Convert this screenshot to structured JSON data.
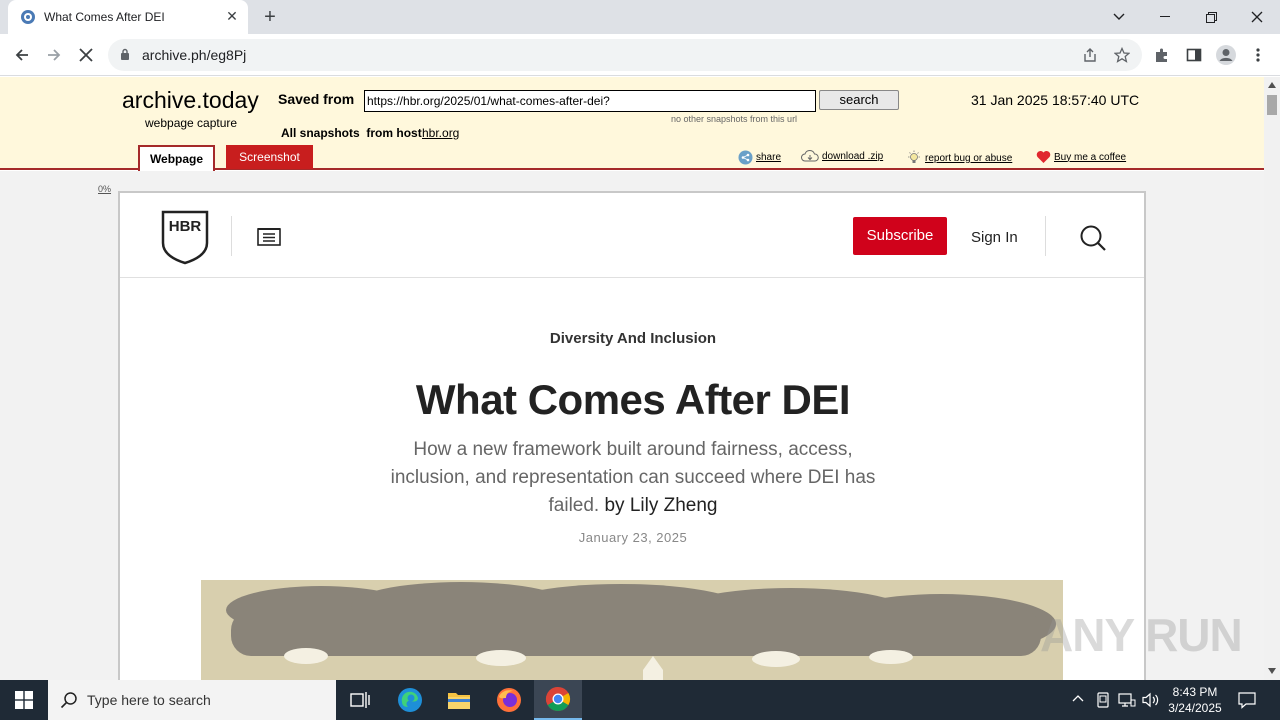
{
  "browser": {
    "tab_title": "What Comes After DEI",
    "new_tab_label": "+",
    "url": "archive.ph/eg8Pj"
  },
  "archive": {
    "logo": "archive.today",
    "logo_sub": "webpage capture",
    "saved_from_label": "Saved from",
    "saved_url": "https://hbr.org/2025/01/what-comes-after-dei?",
    "search_label": "search",
    "no_snapshots": "no other snapshots from this url",
    "datetime": "31 Jan 2025 18:57:40 UTC",
    "all_snapshots_label": "All snapshots",
    "from_host_label": "from host",
    "host": "hbr.org",
    "tab_webpage": "Webpage",
    "tab_screenshot": "Screenshot",
    "share": "share",
    "download": "download .zip",
    "report": "report bug or abuse",
    "coffee": "Buy me a coffee",
    "zoom_pct": "0%"
  },
  "hbr": {
    "logo": "HBR",
    "subscribe": "Subscribe",
    "sign_in": "Sign In",
    "kicker": "Diversity And Inclusion",
    "headline": "What Comes After DEI",
    "dek": "How a new framework built around fairness, access, inclusion, and representation can succeed where DEI has failed.",
    "byline": "by Lily Zheng",
    "date": "January 23, 2025"
  },
  "taskbar": {
    "search_placeholder": "Type here to search",
    "time": "8:43 PM",
    "date": "3/24/2025"
  },
  "watermark": "ANY RUN"
}
